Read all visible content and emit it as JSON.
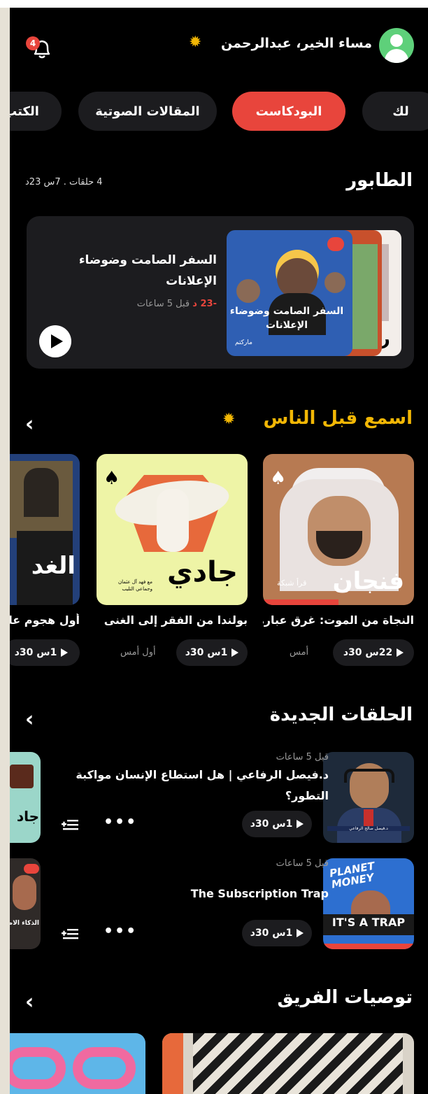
{
  "header": {
    "greeting": "مساء الخير، عبدالرحمن",
    "notification_count": "4"
  },
  "tabs": [
    {
      "label": "لك",
      "active": false
    },
    {
      "label": "البودكاست",
      "active": true
    },
    {
      "label": "المقالات الصوتية",
      "active": false
    },
    {
      "label": "الكتب",
      "active": false
    }
  ],
  "queue": {
    "title": "الطابور",
    "summary": "4 حلقات . 7س 23د",
    "item": {
      "title": "السفر الصامت وضوضاء الإعلانات",
      "remaining": "-23 د",
      "ago": "قبل 5 ساعات",
      "cover_caption": "السفر الصامت وضوضاء الإعلانات",
      "cover_brand": "ماركتم"
    }
  },
  "listen_first": {
    "title": "اسمع قبل الناس",
    "items": [
      {
        "title": "النجاة من الموت: غرق عبارة",
        "duration": "22س 30د",
        "ago": "أمس",
        "cover_word": "فنجان",
        "cover_sub": "قرأ شبكة"
      },
      {
        "title": "بولندا من الفقر إلى الغنى",
        "duration": "1س 30د",
        "ago": "أول أمس",
        "cover_word": "جادي",
        "cover_sub": "مع فهد آل عثمان وجماعي التليب"
      },
      {
        "title": "أول هجوم على",
        "duration": "1س 30د",
        "ago": "",
        "cover_word": "الغد",
        "cover_sub": ""
      }
    ]
  },
  "new_episodes": {
    "title": "الحلقات الجديدة",
    "items": [
      {
        "ago": "قبل 5 ساعات",
        "title": "د.فيصل الرفاعي | هل استطاع الإنسان مواكبة التطور؟",
        "duration": "1س 30د",
        "cover_caption": "د.فيصل صالح الرفاعي",
        "side_word": "جاد"
      },
      {
        "ago": "قبل 5 ساعات",
        "title": "The Subscription Trap",
        "duration": "1س 30د",
        "cover_top": "PLANET MONEY",
        "cover_bottom": "IT'S A TRAP",
        "side_word": "الذكاء الاصطناعي"
      }
    ]
  },
  "team_picks": {
    "title": "توصيات الفريق"
  },
  "colors": {
    "accent": "#e8453c",
    "gold": "#f2b705",
    "card": "#1c1c1f",
    "avatar": "#5ed07a"
  }
}
